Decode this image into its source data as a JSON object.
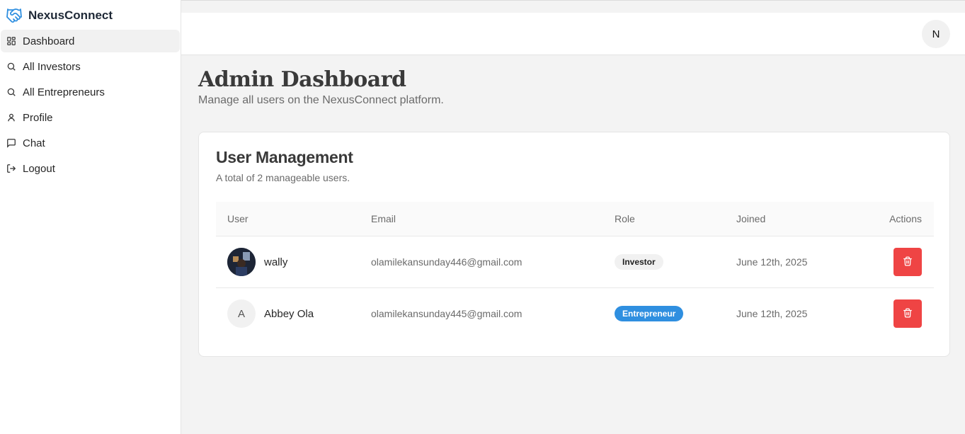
{
  "brand": {
    "name": "NexusConnect",
    "icon": "handshake-icon",
    "accent": "#2f8fe0"
  },
  "sidebar": {
    "items": [
      {
        "label": "Dashboard",
        "icon": "dashboard-icon",
        "active": true
      },
      {
        "label": "All Investors",
        "icon": "search-icon"
      },
      {
        "label": "All Entrepreneurs",
        "icon": "search-icon"
      },
      {
        "label": "Profile",
        "icon": "user-icon"
      },
      {
        "label": "Chat",
        "icon": "chat-icon"
      },
      {
        "label": "Logout",
        "icon": "logout-icon"
      }
    ]
  },
  "header": {
    "avatar_initial": "N"
  },
  "main": {
    "title": "Admin Dashboard",
    "subtitle": "Manage all users on the NexusConnect platform."
  },
  "user_management": {
    "title": "User Management",
    "subtitle": "A total of 2 manageable users.",
    "columns": [
      "User",
      "Email",
      "Role",
      "Joined",
      "Actions"
    ],
    "rows": [
      {
        "name": "wally",
        "avatar": "photo",
        "email": "olamilekansunday446@gmail.com",
        "role": "Investor",
        "joined": "June 12th, 2025"
      },
      {
        "name": "Abbey Ola",
        "avatar_initial": "A",
        "email": "olamilekansunday445@gmail.com",
        "role": "Entrepreneur",
        "joined": "June 12th, 2025"
      }
    ]
  },
  "colors": {
    "danger": "#ef4444",
    "entrepreneur_badge": "#2f8fe0",
    "investor_badge": "#f1f1f1"
  }
}
